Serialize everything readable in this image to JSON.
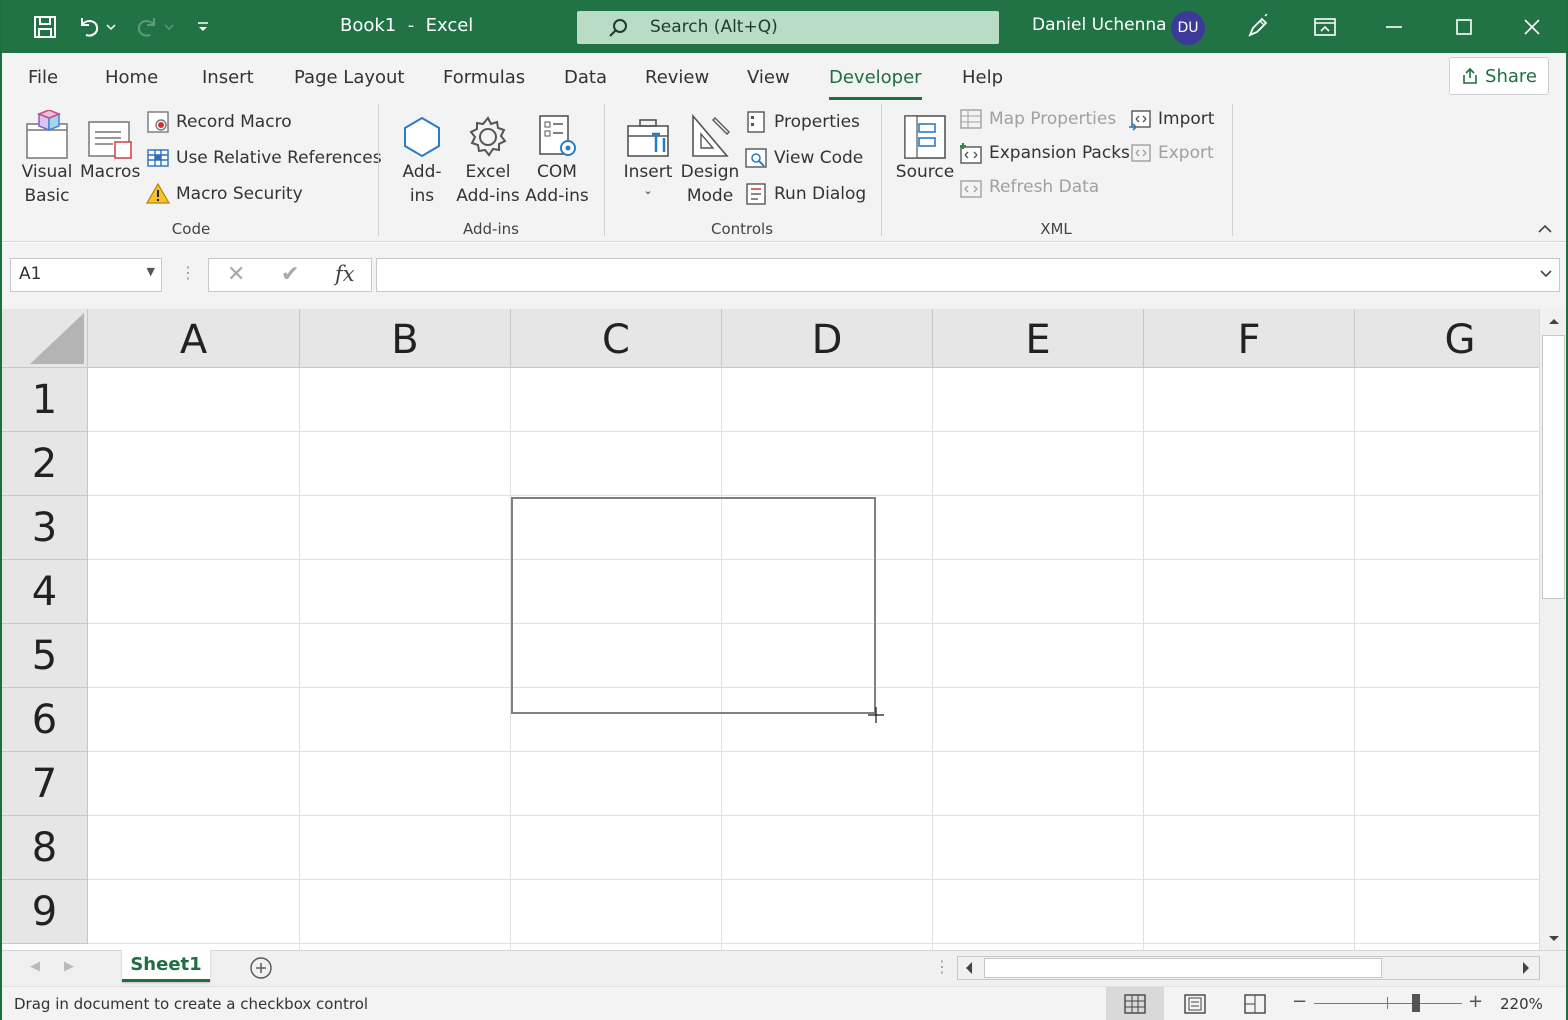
{
  "titlebar": {
    "doc_title": "Book1  -  Excel",
    "search_placeholder": "Search (Alt+Q)",
    "user_name": "Daniel Uchenna",
    "user_initials": "DU"
  },
  "tabs": [
    "File",
    "Home",
    "Insert",
    "Page Layout",
    "Formulas",
    "Data",
    "Review",
    "View",
    "Developer",
    "Help"
  ],
  "active_tab": "Developer",
  "share_label": "Share",
  "ribbon": {
    "code": {
      "label": "Code",
      "visual_basic": "Visual\nBasic",
      "macros": "Macros",
      "record_macro": "Record Macro",
      "use_relative_references": "Use Relative References",
      "macro_security": "Macro Security"
    },
    "addins": {
      "label": "Add-ins",
      "add_ins": "Add-\nins",
      "excel_add_ins": "Excel\nAdd-ins",
      "com_add_ins": "COM\nAdd-ins"
    },
    "controls": {
      "label": "Controls",
      "insert": "Insert",
      "design_mode": "Design\nMode",
      "properties": "Properties",
      "view_code": "View Code",
      "run_dialog": "Run Dialog"
    },
    "xml": {
      "label": "XML",
      "source": "Source",
      "map_properties": "Map Properties",
      "expansion_packs": "Expansion Packs",
      "refresh_data": "Refresh Data",
      "import": "Import",
      "export": "Export"
    }
  },
  "formula_bar": {
    "name_box": "A1",
    "cancel": "✕",
    "enter": "✔",
    "fx": "fx",
    "value": ""
  },
  "grid": {
    "columns": [
      "A",
      "B",
      "C",
      "D",
      "E",
      "F",
      "G"
    ],
    "rows": [
      "1",
      "2",
      "3",
      "4",
      "5",
      "6",
      "7",
      "8",
      "9"
    ]
  },
  "sheets": [
    "Sheet1"
  ],
  "status": {
    "message": "Drag in document to create a checkbox control",
    "zoom": "220%"
  },
  "colors": {
    "accent": "#217346",
    "avatar": "#3b3a99"
  }
}
